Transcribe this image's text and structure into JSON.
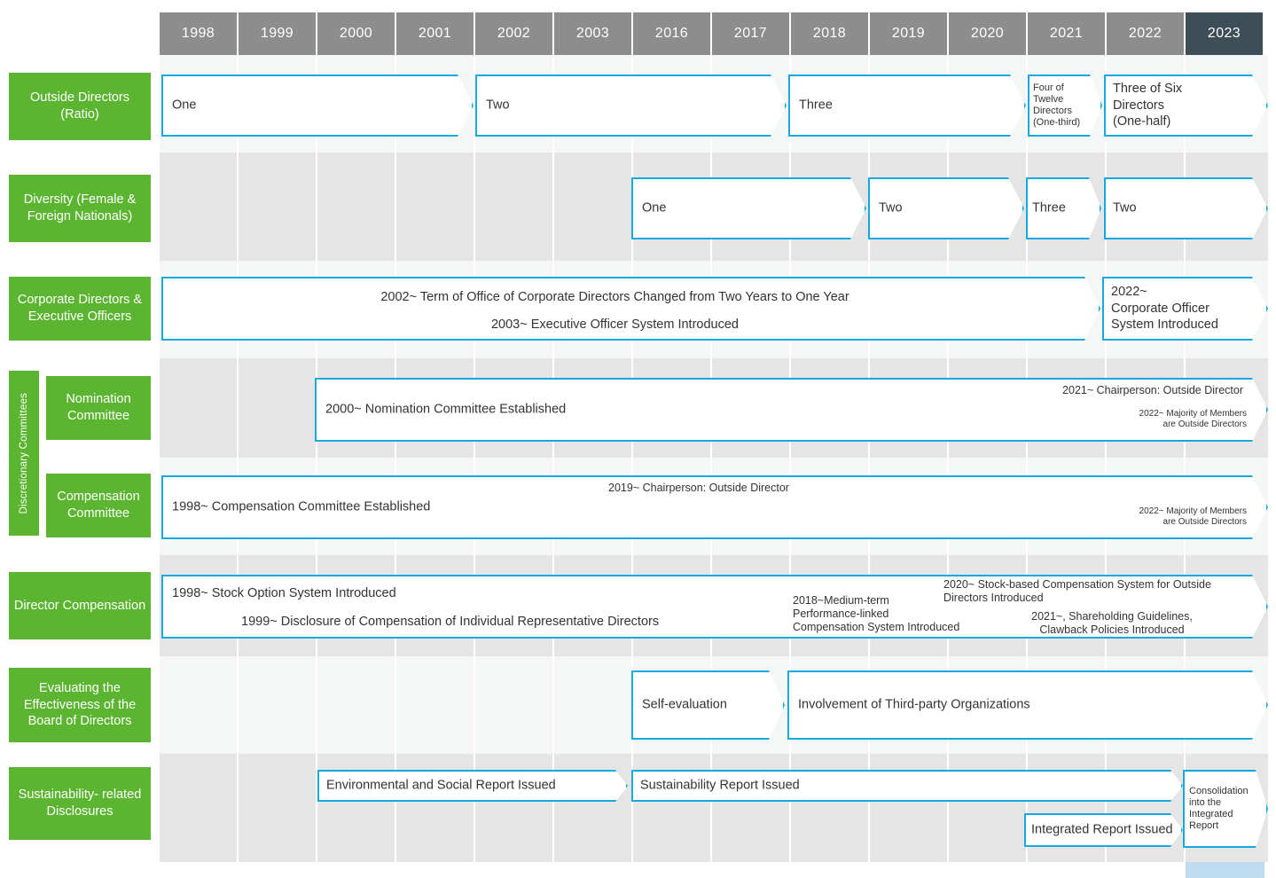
{
  "chart_data": {
    "type": "table",
    "title": "Corporate Governance Enhancement Timeline",
    "years": [
      "1998",
      "1999",
      "2000",
      "2001",
      "2002",
      "2003",
      "2016",
      "2017",
      "2018",
      "2019",
      "2020",
      "2021",
      "2022",
      "2023"
    ],
    "current_year": "2023",
    "axis_break_after": "2003",
    "colors": {
      "header": "#8d8d8d",
      "header_current": "#3e4e57",
      "current_column": "#bfdbef",
      "label_green": "#5cb531",
      "arrow_border": "#17a8e0",
      "band_gray": "#e5e5e5",
      "band_light": "#f5f6f6"
    },
    "rows": [
      {
        "label": "Outside\nDirectors\n(Ratio)",
        "items": [
          {
            "text": "One",
            "start": "1998",
            "end": "2001"
          },
          {
            "text": "Two",
            "start": "2002",
            "end": "2017"
          },
          {
            "text": "Three",
            "start": "2017",
            "end": "2020"
          },
          {
            "text": "Four of\nTwelve\nDirectors\n(One-third)",
            "start": "2021",
            "end": "2021"
          },
          {
            "text": "Three of Six\nDirectors\n(One-half)",
            "start": "2022",
            "end": "2023"
          }
        ]
      },
      {
        "label": "Diversity\n(Female & Foreign\nNationals)",
        "items": [
          {
            "text": "One",
            "start": "2016",
            "end": "2017"
          },
          {
            "text": "Two",
            "start": "2018",
            "end": "2019"
          },
          {
            "text": "Three",
            "start": "2021",
            "end": "2021"
          },
          {
            "text": "Two",
            "start": "2022",
            "end": "2023"
          }
        ]
      },
      {
        "label": "Corporate\nDirectors &\nExecutive Officers",
        "items": [
          {
            "text": "2002~ Term of Office of Corporate  Directors Changed from Two Years to One Year\n2003~ Executive Officer System Introduced",
            "start": "1998",
            "end": "2021"
          },
          {
            "text": "2022~\nCorporate Officer\nSystem Introduced",
            "start": "2022",
            "end": "2023"
          }
        ]
      },
      {
        "group_label": "Discretionary Committees",
        "label": "Nomination\nCommittee",
        "items": [
          {
            "text": "2000~ Nomination Committee Established",
            "start": "2000",
            "end": "2023"
          },
          {
            "text": "2021~ Chairperson: Outside Director",
            "align": "right"
          },
          {
            "text": "2022~ Majority of Members\nare Outside Directors",
            "align": "right"
          }
        ]
      },
      {
        "label": "Compensation\nCommittee",
        "items": [
          {
            "text": "1998~ Compensation Committee Established",
            "start": "1998",
            "end": "2023"
          },
          {
            "text": "2019~ Chairperson: Outside Director",
            "align": "right"
          },
          {
            "text": "2022~ Majority of Members\nare Outside Directors",
            "align": "right"
          }
        ]
      },
      {
        "label": "Director\nCompensation",
        "items": [
          {
            "text": "1998~ Stock Option System Introduced",
            "start": "1998",
            "end": "2023"
          },
          {
            "text": "1999~ Disclosure of Compensation of Individual Representative Directors"
          },
          {
            "text": "2018~Medium-term\nPerformance-linked\nCompensation System Introduced"
          },
          {
            "text": "2020~ Stock-based Compensation System for Outside\nDirectors Introduced"
          },
          {
            "text": "2021~, Shareholding Guidelines,\nClawback Policies Introduced"
          }
        ]
      },
      {
        "label": "Evaluating\nthe Effectiveness\nof the Board of\nDirectors",
        "items": [
          {
            "text": "Self-evaluation",
            "start": "2016",
            "end": "2017"
          },
          {
            "text": "Involvement of Third-party Organizations",
            "start": "2017",
            "end": "2023"
          }
        ]
      },
      {
        "label": "Sustainability-\nrelated\nDisclosures",
        "items": [
          {
            "text": "Environmental and Social Report Issued",
            "start": "2000",
            "end": "2003"
          },
          {
            "text": "Sustainability Report Issued",
            "start": "2016",
            "end": "2022"
          },
          {
            "text": "Integrated Report Issued",
            "start": "2021",
            "end": "2022"
          },
          {
            "text": "Consolidation\ninto the\nIntegrated\nReport",
            "start": "2023",
            "end": "2023"
          }
        ]
      }
    ]
  },
  "header": {
    "years": [
      "1998",
      "1999",
      "2000",
      "2001",
      "2002",
      "2003",
      "2016",
      "2017",
      "2018",
      "2019",
      "2020",
      "2021",
      "2022",
      "2023"
    ]
  },
  "labels": {
    "outside_directors": "Outside\nDirectors\n(Ratio)",
    "diversity": "Diversity\n(Female & Foreign\nNationals)",
    "corporate_directors": "Corporate\nDirectors &\nExecutive Officers",
    "discretionary": "Discretionary Committees",
    "nomination": "Nomination\nCommittee",
    "compensation_cmte": "Compensation\nCommittee",
    "director_compensation": "Director\nCompensation",
    "evaluating": "Evaluating\nthe Effectiveness\nof the Board of\nDirectors",
    "sustainability": "Sustainability-\nrelated\nDisclosures"
  },
  "r1": {
    "a": "One",
    "b": "Two",
    "c": "Three",
    "d": "Four of\nTwelve\nDirectors\n(One-third)",
    "e": "Three of Six\nDirectors\n(One-half)"
  },
  "r2": {
    "a": "One",
    "b": "Two",
    "c": "Three",
    "d": "Two"
  },
  "r3": {
    "a1": "2002~ Term of Office of Corporate  Directors Changed from Two Years to One Year",
    "a2": "2003~ Executive Officer System Introduced",
    "b": "2022~\nCorporate Officer\nSystem Introduced"
  },
  "r4": {
    "a": "2000~ Nomination Committee Established",
    "b": "2021~ Chairperson: Outside Director",
    "c": "2022~ Majority of Members\nare Outside Directors"
  },
  "r5": {
    "a": "1998~ Compensation Committee Established",
    "b": "2019~ Chairperson: Outside Director",
    "c": "2022~ Majority of Members\nare Outside Directors"
  },
  "r6": {
    "a": "1998~ Stock Option System Introduced",
    "b": "1999~ Disclosure of Compensation of Individual Representative Directors",
    "c": "2018~Medium-term\nPerformance-linked\nCompensation System Introduced",
    "d": "2020~ Stock-based Compensation System for Outside\nDirectors Introduced",
    "e": "2021~, Shareholding Guidelines,\nClawback Policies Introduced"
  },
  "r7": {
    "a": "Self-evaluation",
    "b": "Involvement of Third-party Organizations"
  },
  "r8": {
    "a": "Environmental and Social Report Issued",
    "b": "Sustainability Report Issued",
    "c": "Integrated Report Issued",
    "d": "Consolidation\ninto the\nIntegrated\nReport"
  }
}
